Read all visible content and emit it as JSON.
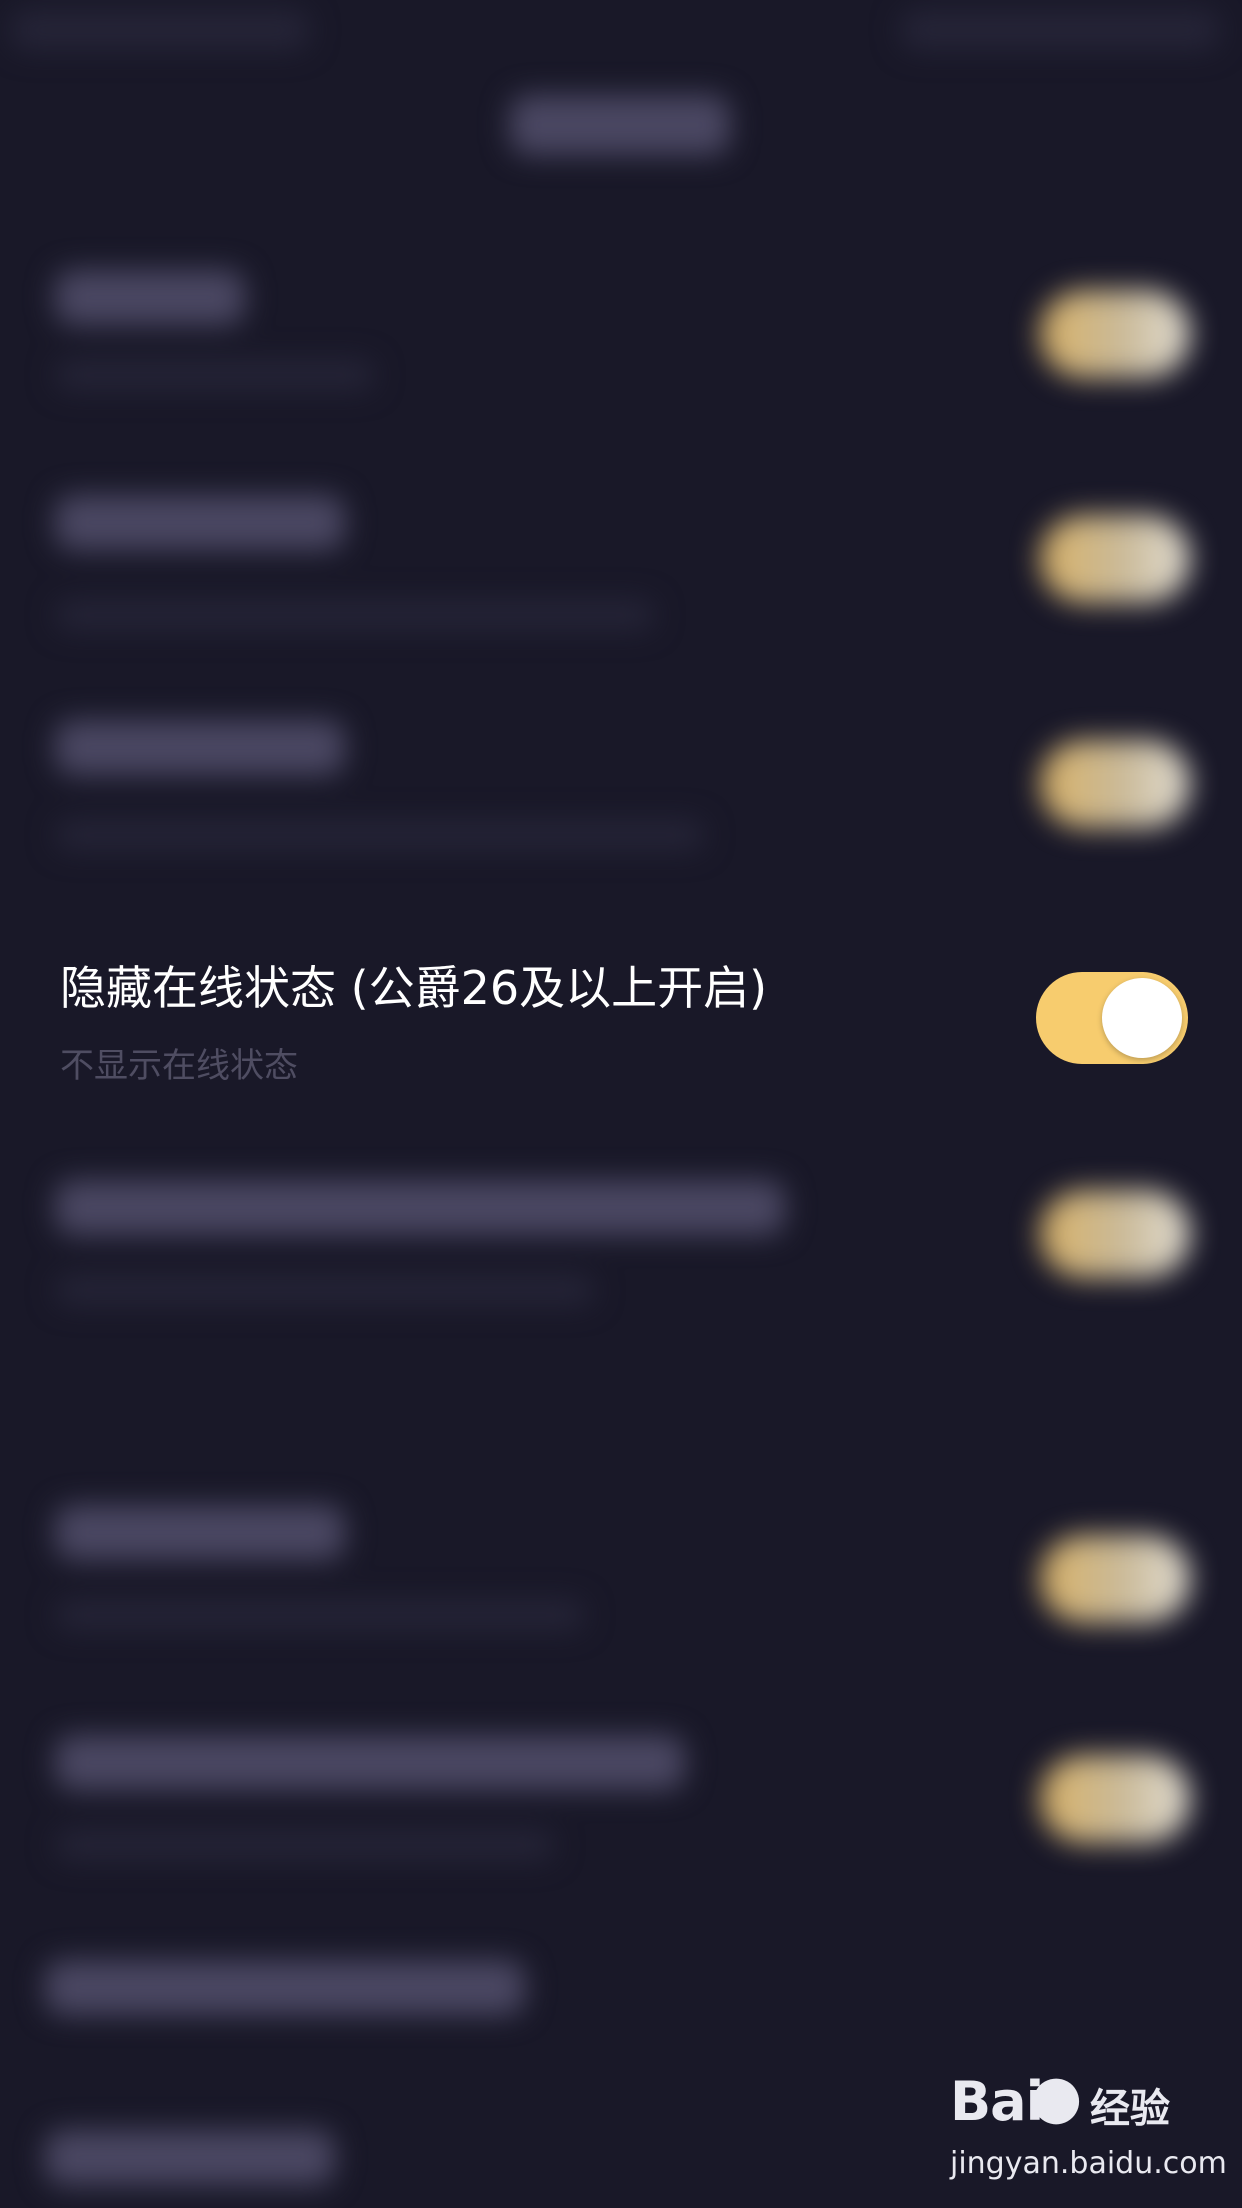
{
  "focused_setting": {
    "title": "隐藏在线状态 (公爵26及以上开启)",
    "subtitle": "不显示在线状态",
    "toggle_on": true,
    "toggle_color": "#f7cc6e"
  },
  "watermark": {
    "logo": "Bai",
    "logo_symbol": "paw-icon",
    "brand_cn": "经验",
    "url": "jingyan.baidu.com"
  },
  "colors": {
    "background": "#191828",
    "title": "#ffffff",
    "subtitle": "#4f4d62",
    "accent": "#f7cc6e"
  }
}
